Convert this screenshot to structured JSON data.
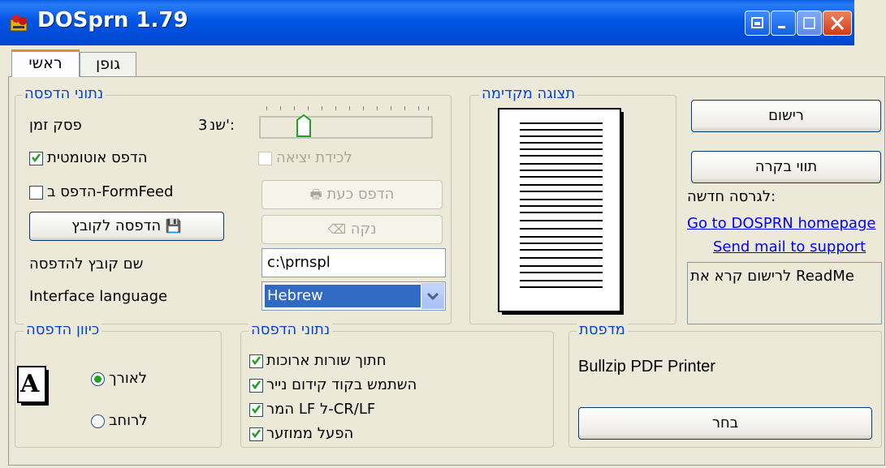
{
  "window": {
    "title": "DOSprn 1.79"
  },
  "tabs": [
    {
      "label": "ראשי"
    },
    {
      "label": "גופן"
    }
  ],
  "print_data": {
    "legend": "נתוני הדפסה",
    "timeout_label": "פסק זמן",
    "seconds_label": "שנ':",
    "seconds_value": "3",
    "auto_print_label": "הדפס אוטומטית",
    "capture_exit_label": "לכידת יציאה",
    "formfeed_label": "הדפס ב-FormFeed",
    "print_now_label": "הדפס כעת",
    "clear_label": "נקה",
    "print_to_file_label": "הדפסה לקובץ",
    "filename_label": "שם קובץ להדפסה",
    "filename_value": "c:\\prnspl",
    "interface_language_label": "Interface language",
    "interface_language_value": "Hebrew"
  },
  "preview": {
    "legend": "תצוגה מקדימה"
  },
  "right": {
    "register_label": "רישום",
    "control_label": "תווי בקרה",
    "new_version_label": "לגרסה חדשה:",
    "homepage_link": "Go to DOSPRN homepage",
    "support_link": "Send mail to support",
    "readme_text": "לרישום קרא את ReadMe"
  },
  "orientation": {
    "legend": "כיוון הדפסה",
    "portrait_label": "לאורך",
    "landscape_label": "לרוחב",
    "icon_letter": "A"
  },
  "print_options": {
    "legend": "נתוני הדפסה",
    "items": [
      {
        "label": "חתוך שורות ארוכות"
      },
      {
        "label": "השתמש בקוד קידום נייר"
      },
      {
        "label": "המר LF ל-CR/LF"
      },
      {
        "label": "הפעל ממוזער"
      }
    ]
  },
  "printer": {
    "legend": "מדפסת",
    "name": "Bullzip PDF Printer",
    "choose_label": "בחר"
  }
}
